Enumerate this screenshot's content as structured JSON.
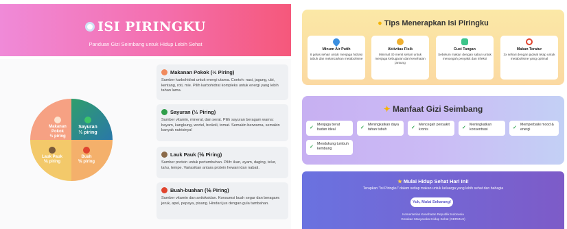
{
  "hero": {
    "title": "ISI PIRINGKU",
    "subtitle": "Panduan Gizi Seimbang untuk Hidup Lebih Sehat"
  },
  "wheel": {
    "q1": {
      "name": "Makanan Pokok",
      "portion": "⅓ piring",
      "color": "#f6a183"
    },
    "q2": {
      "name": "Sayuran",
      "portion": "⅓ piring",
      "color": "#2f9e6c"
    },
    "q3": {
      "name": "Lauk Pauk",
      "portion": "⅙ piring",
      "color": "#f3c96a"
    },
    "q4": {
      "name": "Buah",
      "portion": "⅙ piring",
      "color": "#f4b06b"
    }
  },
  "cards": [
    {
      "title": "Makanan Pokok (⅓ Piring)",
      "icon": "grain-icon",
      "text": "Sumber karbohidrat untuk energi utama. Contoh: nasi, jagung, ubi, kentang, roti, mie. Pilih karbohidrat kompleks untuk energi yang lebih tahan lama."
    },
    {
      "title": "Sayuran (⅓ Piring)",
      "icon": "vegetable-icon",
      "text": "Sumber vitamin, mineral, dan serat. Pilih sayuran beragam warna: bayam, kangkung, wortel, brokoli, tomat. Semakin berwarna, semakin banyak nutrisinya!"
    },
    {
      "title": "Lauk Pauk (⅙ Piring)",
      "icon": "protein-icon",
      "text": "Sumber protein untuk pertumbuhan. Pilih: ikan, ayam, daging, telur, tahu, tempe. Variasikan antara protein hewani dan nabati."
    },
    {
      "title": "Buah-buahan (⅙ Piring)",
      "icon": "fruit-icon",
      "text": "Sumber vitamin dan antioksidan. Konsumsi buah segar dan beragam: jeruk, apel, pepaya, pisang. Hindari jus dengan gula tambahan."
    }
  ],
  "tips": {
    "title": "Tips Menerapkan Isi Piringku",
    "items": [
      {
        "icon": "water-drop-icon",
        "title": "Minum Air Putih",
        "text": "8 gelas sehari untuk menjaga hidrasi tubuh dan melancarkan metabolisme"
      },
      {
        "icon": "running-icon",
        "title": "Aktivitas Fisik",
        "text": "Minimal 30 menit sehari untuk menjaga kebugaran dan kesehatan jantung"
      },
      {
        "icon": "soap-icon",
        "title": "Cuci Tangan",
        "text": "Sebelum makan dengan sabun untuk mencegah penyakit dan infeksi"
      },
      {
        "icon": "alarm-clock-icon",
        "title": "Makan Teratur",
        "text": "3x sehari dengan jadwal tetap untuk metabolisme yang optimal"
      }
    ]
  },
  "benefits": {
    "title": "Manfaat Gizi Seimbang",
    "items": [
      "Menjaga berat badan ideal",
      "Meningkatkan daya tahan tubuh",
      "Mencegah penyakit kronis",
      "Meningkatkan konsentrasi",
      "Memperbaiki mood & energi",
      "Mendukung tumbuh kembang"
    ]
  },
  "cta": {
    "title": "Mulai Hidup Sehat Hari Ini!",
    "subtitle": "Terapkan \"Isi Piringku\" dalam setiap makan untuk keluarga yang lebih sehat dan bahagia",
    "button": "Yuk, Mulai Sekarang!",
    "footer1": "Kementerian Kesehatan Republik Indonesia",
    "footer2": "Gerakan Masyarakat Hidup Sehat (GERMAS)"
  },
  "colors": {
    "hero_start": "#f08ad8",
    "hero_end": "#f5587b",
    "tips_bg": "#fbe8a6",
    "benefit_bg": "#c7b0f2",
    "cta_bg": "#6a72e0",
    "check": "#2ea44f"
  }
}
